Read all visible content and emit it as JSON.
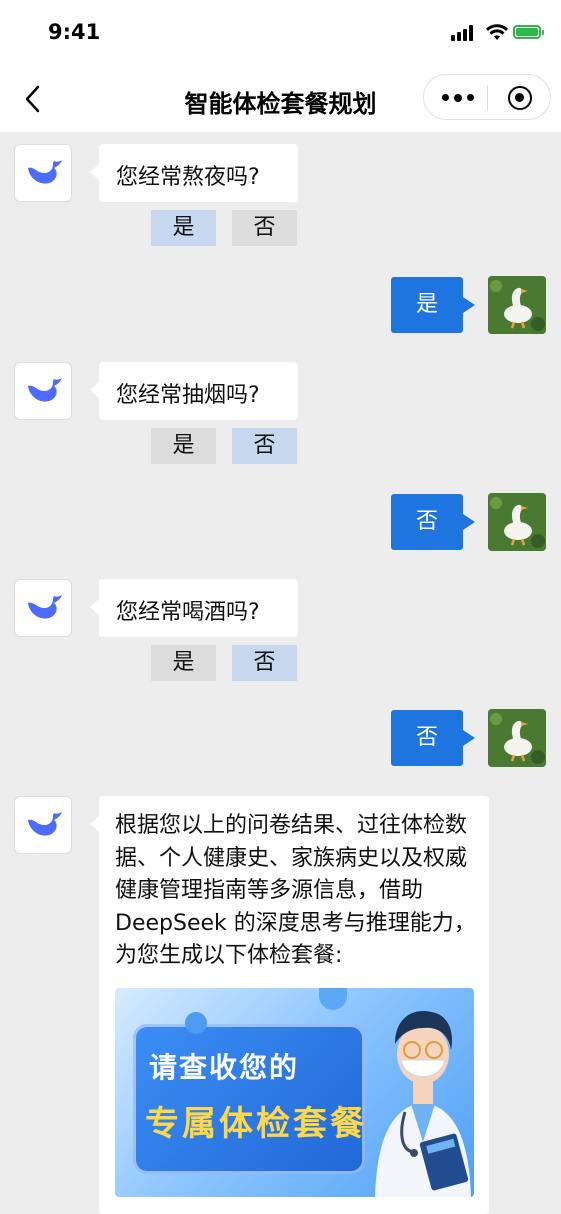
{
  "status_bar": {
    "time": "9:41",
    "battery_color": "#2db84a"
  },
  "nav": {
    "title": "智能体检套餐规划",
    "back_icon": "chevron-left-icon",
    "more_icon": "more-dots-icon",
    "close_icon": "target-icon"
  },
  "messages": [
    {
      "from": "bot",
      "text": "您经常熬夜吗?",
      "options": [
        "是",
        "否"
      ],
      "selected": "是"
    },
    {
      "from": "user",
      "text": "是"
    },
    {
      "from": "bot",
      "text": "您经常抽烟吗?",
      "options": [
        "是",
        "否"
      ],
      "selected": "否"
    },
    {
      "from": "user",
      "text": "否"
    },
    {
      "from": "bot",
      "text": "您经常喝酒吗?",
      "options": [
        "是",
        "否"
      ],
      "selected": "否"
    },
    {
      "from": "user",
      "text": "否"
    }
  ],
  "final_message": {
    "text": "根据您以上的问卷结果、过往体检数据、个人健康史、家族病史以及权威健康管理指南等多源信息，借助 DeepSeek 的深度思考与推理能力，为您生成以下体检套餐:",
    "banner": {
      "line1": "请查收您的",
      "line2": "专属体检套餐"
    }
  },
  "colors": {
    "user_bubble": "#1f75e0",
    "selected_option": "#c7d8ee",
    "unselected_option": "#dcdcdc",
    "chat_bg": "#ededed"
  }
}
